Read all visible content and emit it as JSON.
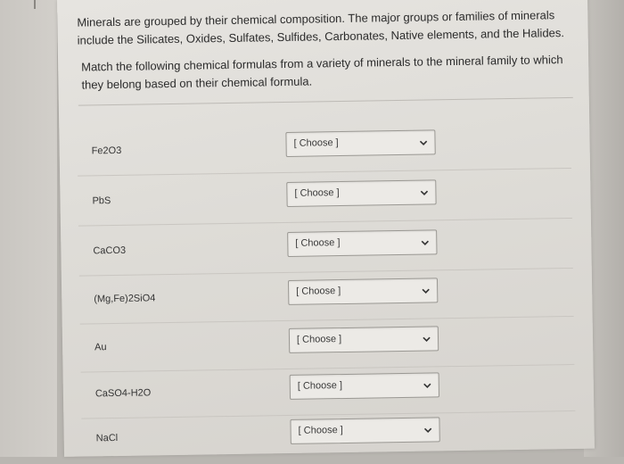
{
  "question": {
    "intro": "Minerals are grouped by their chemical composition. The major groups or families of minerals include the Silicates, Oxides, Sulfates, Sulfides, Carbonates, Native elements, and the Halides.",
    "instruction": "Match the following chemical formulas from a variety of minerals to the mineral family to which they belong based on their chemical formula."
  },
  "rows": [
    {
      "formula": "Fe2O3",
      "select": "[ Choose ]"
    },
    {
      "formula": "PbS",
      "select": "[ Choose ]"
    },
    {
      "formula": "CaCO3",
      "select": "[ Choose ]"
    },
    {
      "formula": "(Mg,Fe)2SiO4",
      "select": "[ Choose ]"
    },
    {
      "formula": "Au",
      "select": "[ Choose ]"
    },
    {
      "formula": "CaSO4-H2O",
      "select": "[ Choose ]"
    },
    {
      "formula": "NaCl",
      "select": "[ Choose ]"
    }
  ],
  "icons": {
    "dropdown": "chevron-down-icon"
  }
}
